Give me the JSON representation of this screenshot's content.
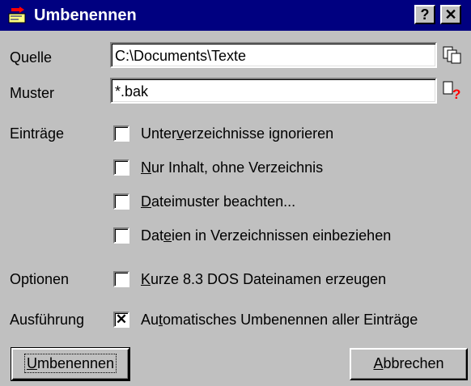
{
  "window": {
    "title": "Umbenennen",
    "help_btn": "?",
    "close_btn": "✕"
  },
  "quelle": {
    "label": "Quelle",
    "value": "C:\\Documents\\Texte",
    "icon": "copy-files-icon"
  },
  "muster": {
    "label": "Muster",
    "value": "*.bak",
    "icon": "file-question-icon"
  },
  "eintraege": {
    "label": "Einträge",
    "options": [
      {
        "pre": "Unter",
        "acc": "v",
        "post": "erzeichnisse ignorieren",
        "checked": false
      },
      {
        "pre": "",
        "acc": "N",
        "post": "ur Inhalt, ohne Verzeichnis",
        "checked": false
      },
      {
        "pre": "",
        "acc": "D",
        "post": "ateimuster beachten...",
        "checked": false
      },
      {
        "pre": "Dat",
        "acc": "e",
        "post": "ien in Verzeichnissen einbeziehen",
        "checked": false
      }
    ]
  },
  "optionen": {
    "label": "Optionen",
    "pre": "",
    "acc": "K",
    "post": "urze 8.3 DOS Dateinamen erzeugen",
    "checked": false
  },
  "ausfuehrung": {
    "label": "Ausführung",
    "pre": "Au",
    "acc": "t",
    "post": "omatisches Umbenennen aller Einträge",
    "checked": true,
    "mark": "✕"
  },
  "buttons": {
    "rename": {
      "acc": "U",
      "post": "mbenennen"
    },
    "cancel": {
      "acc": "A",
      "post": "bbrechen"
    }
  },
  "colors": {
    "titlebar": "#000080",
    "face": "#c0c0c0",
    "alert": "#ff0000"
  }
}
